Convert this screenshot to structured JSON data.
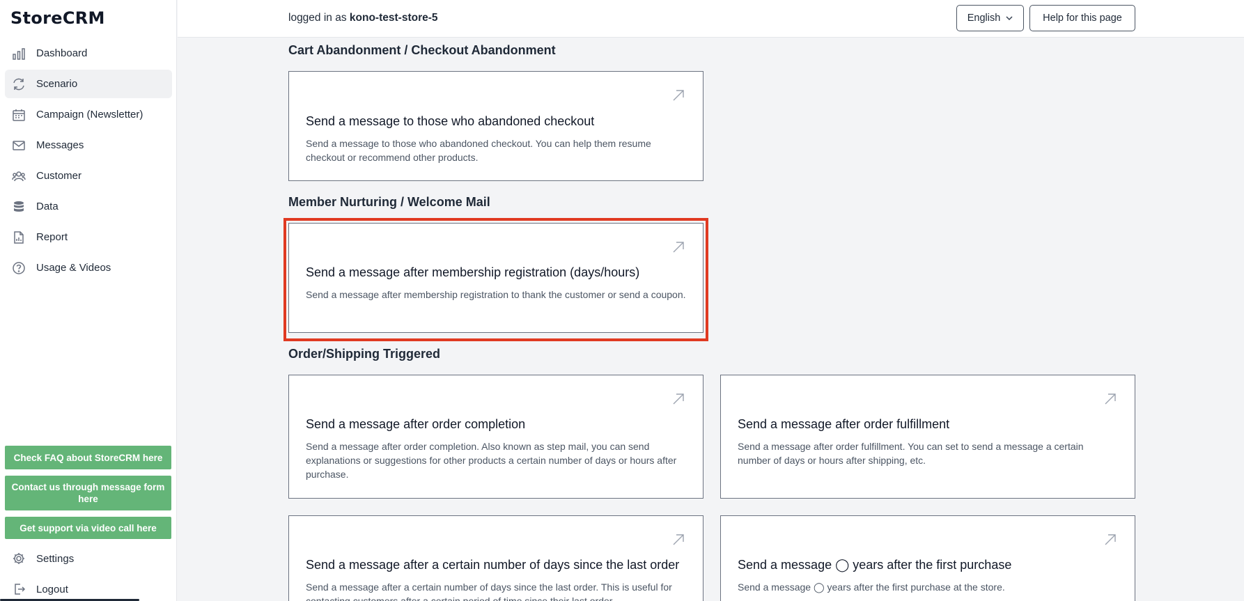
{
  "app": {
    "logo": "StoreCRM"
  },
  "sidebar": {
    "items": [
      {
        "label": "Dashboard",
        "icon": "bar-chart-icon"
      },
      {
        "label": "Scenario",
        "icon": "refresh-icon",
        "active": true
      },
      {
        "label": "Campaign (Newsletter)",
        "icon": "calendar-icon"
      },
      {
        "label": "Messages",
        "icon": "envelope-icon"
      },
      {
        "label": "Customer",
        "icon": "users-icon"
      },
      {
        "label": "Data",
        "icon": "database-icon"
      },
      {
        "label": "Report",
        "icon": "document-chart-icon"
      },
      {
        "label": "Usage & Videos",
        "icon": "question-circle-icon"
      }
    ],
    "help_buttons": [
      "Check FAQ about StoreCRM here",
      "Contact us through message form here",
      "Get support via video call here"
    ],
    "bottom_items": [
      {
        "label": "Settings",
        "icon": "gear-icon"
      },
      {
        "label": "Logout",
        "icon": "logout-icon"
      }
    ]
  },
  "header": {
    "logged_prefix": "logged in as",
    "store_name": "kono-test-store-5",
    "language": "English",
    "help_label": "Help for this page"
  },
  "colors": {
    "help_button": "#64b578",
    "highlight": "#e03a22"
  },
  "sections": [
    {
      "title": "Cart Abandonment / Checkout Abandonment",
      "cards": [
        {
          "title": "Send a message to those who abandoned checkout",
          "desc": "Send a message to those who abandoned checkout. You can help them resume checkout or recommend other products."
        }
      ]
    },
    {
      "title": "Member Nurturing / Welcome Mail",
      "cards": [
        {
          "title": "Send a message after membership registration (days/hours)",
          "desc": "Send a message after membership registration to thank the customer or send a coupon.",
          "highlighted": true
        }
      ]
    },
    {
      "title": "Order/Shipping Triggered",
      "cards": [
        {
          "title": "Send a message after order completion",
          "desc": "Send a message after order completion. Also known as step mail, you can send explanations or suggestions for other products a certain number of days or hours after purchase."
        },
        {
          "title": "Send a message after order fulfillment",
          "desc": "Send a message after order fulfillment. You can set to send a message a certain number of days or hours after shipping, etc."
        },
        {
          "title": "Send a message after a certain number of days since the last order",
          "desc": "Send a message after a certain number of days since the last order. This is useful for contacting customers after a certain period of time since their last order."
        },
        {
          "title": "Send a message ◯ years after the first purchase",
          "desc": "Send a message ◯ years after the first purchase at the store."
        }
      ]
    }
  ]
}
